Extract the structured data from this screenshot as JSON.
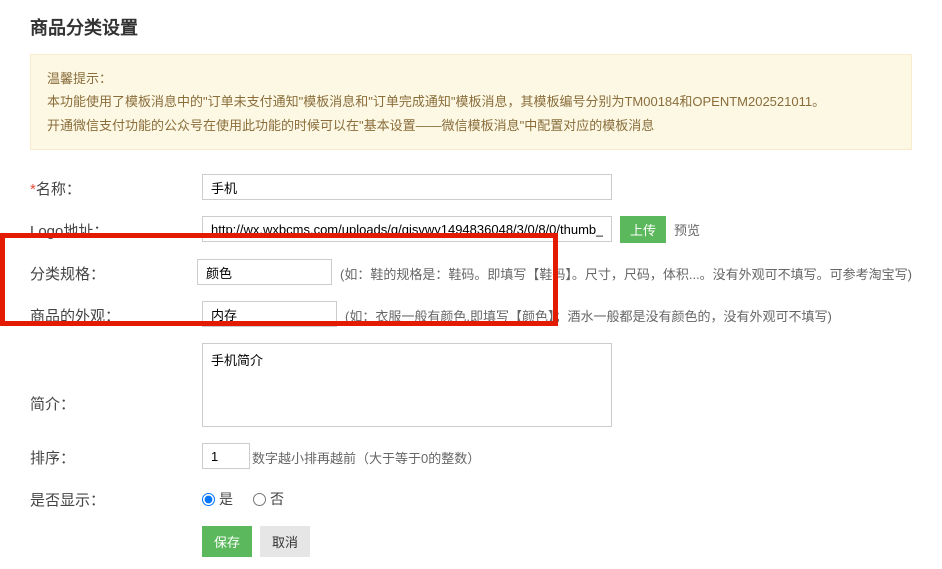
{
  "page_title": "商品分类设置",
  "alert": {
    "line1": "温馨提示：",
    "line2": "本功能使用了模板消息中的\"订单未支付通知\"模板消息和\"订单完成通知\"模板消息，其模板编号分别为TM00184和OPENTM202521011。",
    "line3": "开通微信支付功能的公众号在使用此功能的时候可以在\"基本设置——微信模板消息\"中配置对应的模板消息"
  },
  "fields": {
    "name_label": "名称：",
    "name_value": "手机",
    "logo_label": "Logo地址：",
    "logo_value": "http://wx.wxbcms.com/uploads/g/gisvwy1494836048/3/0/8/0/thumb_",
    "upload_btn": "上传",
    "preview_label": "预览",
    "spec_label": "分类规格：",
    "spec_value": "颜色",
    "spec_hint": "(如：鞋的规格是：鞋码。即填写【鞋码】。尺寸，尺码，体积...。没有外观可不填写。可参考淘宝写)",
    "look_label": "商品的外观：",
    "look_value": "内存",
    "look_hint": "(如：衣服一般有颜色,即填写【颜色】；酒水一般都是没有颜色的，没有外观可不填写)",
    "intro_label": "简介：",
    "intro_value": "手机简介",
    "sort_label": "排序：",
    "sort_value": "1",
    "sort_hint": "数字越小排再越前（大于等于0的整数）",
    "display_label": "是否显示：",
    "display_yes": "是",
    "display_no": "否",
    "save_btn": "保存",
    "cancel_btn": "取消"
  }
}
